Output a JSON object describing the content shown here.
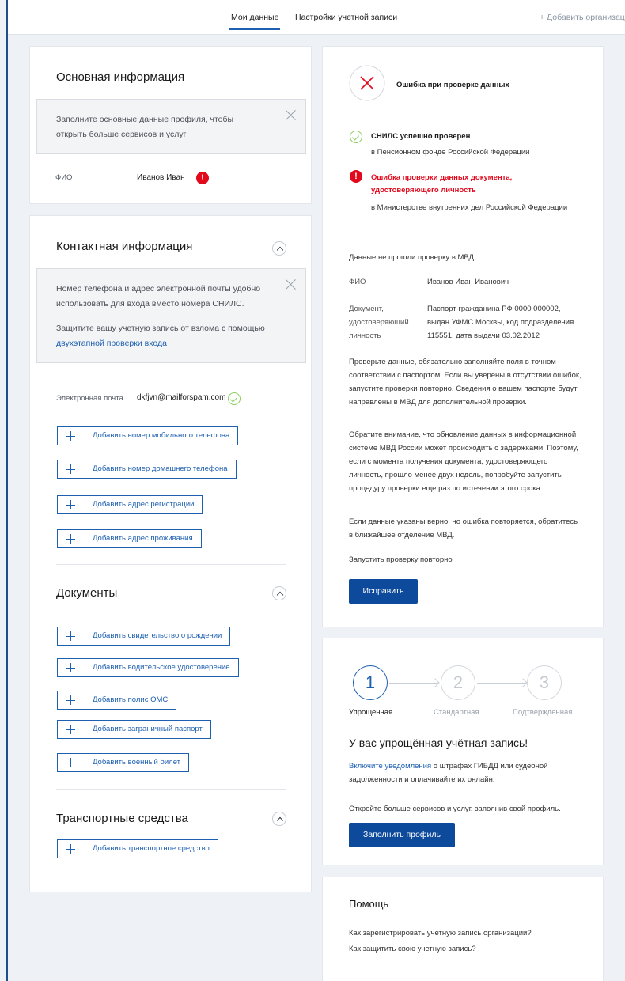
{
  "nav": {
    "tabs": [
      {
        "label": "Мои данные",
        "active": true
      },
      {
        "label": "Настройки учетной записи",
        "active": false
      }
    ],
    "add_org": "+ Добавить организацию"
  },
  "basic_info": {
    "title": "Основная информация",
    "notice": "Заполните основные данные профиля, чтобы открыть больше сервисов и услуг",
    "fio_label": "ФИО",
    "fio_value": "Иванов Иван",
    "error_mark": "!"
  },
  "contact": {
    "title": "Контактная информация",
    "notice_line1": "Номер телефона и адрес электронной почты удобно использовать для входа вместо номера СНИЛС.",
    "notice_line2": "Защитите вашу учетную запись от взлома с помощью",
    "notice_link": "двухэтапной проверки входа",
    "email_label": "Электронная почта",
    "email_value": "dkfjvn@mailforspam.com",
    "buttons": [
      "Добавить номер мобильного телефона",
      "Добавить номер домашнего телефона",
      "Добавить адрес регистрации",
      "Добавить адрес проживания"
    ]
  },
  "documents": {
    "title": "Документы",
    "buttons": [
      "Добавить свидетельство о рождении",
      "Добавить водительское удостоверение",
      "Добавить полис ОМС",
      "Добавить заграничный паспорт",
      "Добавить военный билет"
    ]
  },
  "vehicles": {
    "title": "Транспортные средства",
    "button": "Добавить транспортное средство"
  },
  "verification": {
    "header": "Ошибка при проверке данных",
    "snils_title": "СНИЛС успешно проверен",
    "snils_sub": "в Пенсионном фонде Российской Федерации",
    "doc_error_title1": "Ошибка проверки данных документа,",
    "doc_error_title2": "удостоверяющего личность",
    "doc_error_sub": "в Министерстве внутренних дел Российской Федерации",
    "failed_text": "Данные не прошли проверку в МВД.",
    "fio_label": "ФИО",
    "fio_value": "Иванов Иван Иванович",
    "doc_label1": "Документ,",
    "doc_label2": "удостоверяющий",
    "doc_label3": "личность",
    "doc_value1": "Паспорт гражданина РФ 0000 000002,",
    "doc_value2": "выдан УФМС Москвы, код подразделения",
    "doc_value3": "115551, дата выдачи 03.02.2012",
    "para1": "Проверьте данные, обязательно заполняйте поля в точном соответствии с паспортом. Если вы уверены в отсутствии ошибок, запустите проверки повторно. Сведения о вашем паспорте будут направлены в МВД для дополнительной проверки.",
    "para2": "Обратите внимание, что обновление данных в информационной системе МВД России может происходить с задержками. Поэтому, если с момента получения документа, удостоверяющего личность, прошло менее двух недель, попробуйте запустить процедуру проверки еще раз по истечении этого срока.",
    "para3": "Если данные указаны верно, но ошибка повторяется, обратитесь в ближайшее отделение МВД.",
    "retry_link": "Запустить проверку повторно",
    "fix_button": "Исправить"
  },
  "account_level": {
    "steps": [
      {
        "num": "1",
        "label": "Упрощенная",
        "active": true
      },
      {
        "num": "2",
        "label": "Стандартная",
        "active": false
      },
      {
        "num": "3",
        "label": "Подтвержденная",
        "active": false
      }
    ],
    "title": "У вас упрощённая учётная запись!",
    "notif_link": "Включите уведомления",
    "notif_text1": " о штрафах ГИБДД или судебной",
    "notif_text2": "задолженности и оплачивайте их онлайн.",
    "open_more": "Откройте больше сервисов и услуг, заполнив свой профиль.",
    "fill_button": "Заполнить профиль"
  },
  "help": {
    "title": "Помощь",
    "links": [
      "Как зарегистрировать учетную запись организации?",
      "Как защитить свою учетную запись?"
    ]
  },
  "colors": {
    "accent": "#1d5fb0",
    "error": "#e3091c",
    "success": "#8ccf5f",
    "primary_button": "#0d4a9c"
  }
}
